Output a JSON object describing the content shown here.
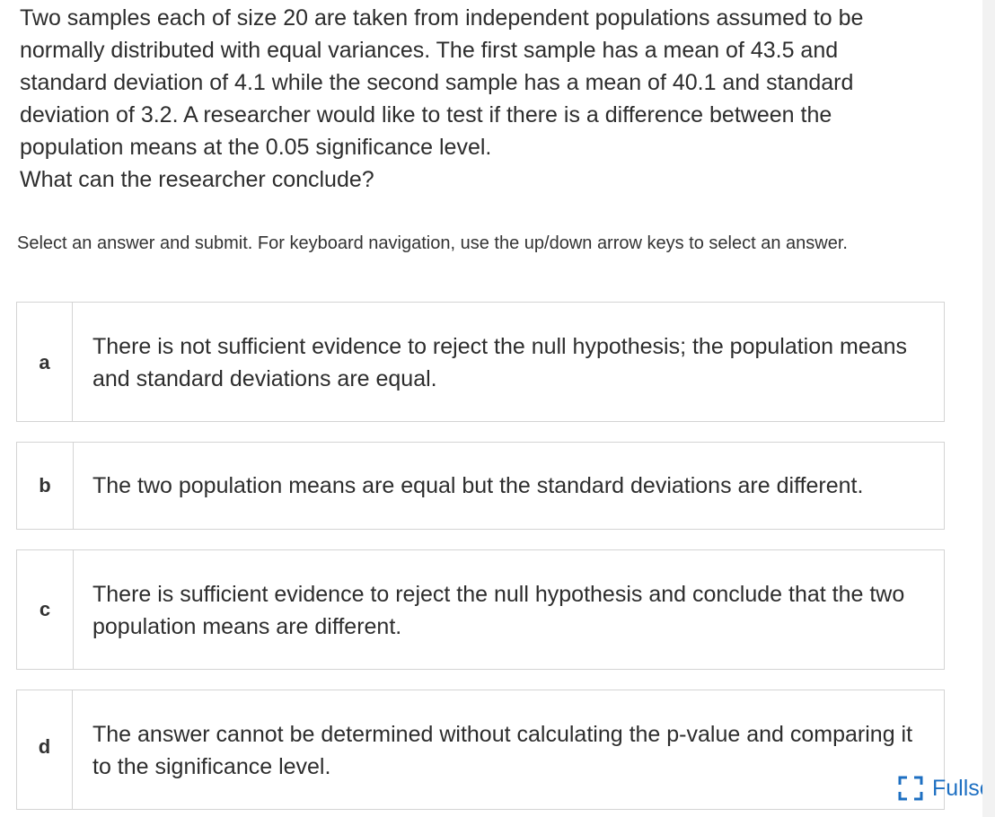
{
  "question": {
    "paragraph1": "Two samples each of size 20 are taken from independent populations assumed to be normally distributed with equal variances. The first sample has a mean of 43.5 and standard deviation of 4.1 while the second sample has a mean of 40.1 and standard deviation of 3.2. A researcher would like to test if there is a difference between the population means at the 0.05 significance level.",
    "prompt": "What can the researcher conclude?"
  },
  "instructions": "Select an answer and submit. For keyboard navigation, use the up/down arrow keys to select an answer.",
  "options": [
    {
      "letter": "a",
      "text": "There is not sufficient evidence to reject the null hypothesis; the population means and standard deviations are equal."
    },
    {
      "letter": "b",
      "text": "The two population means are equal but the standard deviations are different."
    },
    {
      "letter": "c",
      "text": "There is sufficient evidence to reject the null hypothesis and conclude that the two population means are different."
    },
    {
      "letter": "d",
      "text": "The answer cannot be determined without calculating the p-value and comparing it to the significance level."
    }
  ],
  "fullscreen": {
    "label": "Fullscreen",
    "icon": "fullscreen-icon",
    "color": "#1d6fc2"
  }
}
